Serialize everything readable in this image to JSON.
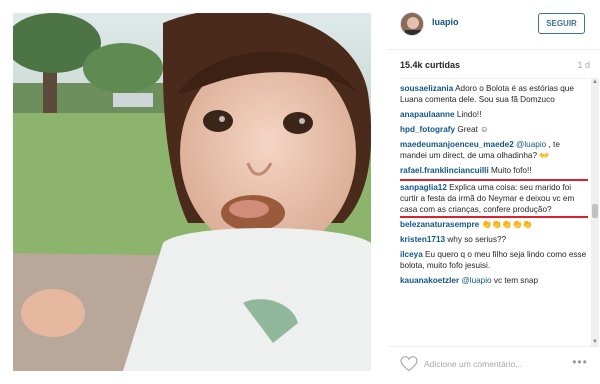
{
  "post": {
    "username": "luapio",
    "follow_label": "SEGUIR",
    "likes": "15.4k curtidas",
    "age": "1 d"
  },
  "comments": [
    {
      "user": "sousaelizania",
      "text": " Adoro o Bolota é as estórias que Luana comenta dele. Sou sua fã Domzuco"
    },
    {
      "user": "anapaulaanne",
      "text": " Lindo!!"
    },
    {
      "user": "hpd_fotografy",
      "text": " Great ☺"
    },
    {
      "user": "maedeumanjoenceu_maede2",
      "mention": " @luapio",
      "text": " , te mandei um direct, de uma olhadinha? 👐"
    },
    {
      "user": "rafael.franklinciancuilli",
      "text": " Muito fofo!!"
    },
    {
      "user": "sanpaglia12",
      "text": " Explica uma coisa: seu marido foi curtir a festa da irmã do Neymar e deixou vc em casa com as crianças, confere produção?"
    },
    {
      "user": "belezanaturasempre",
      "text": " 👏👏👏👏👏"
    },
    {
      "user": "kristen1713",
      "text": " why so serius??"
    },
    {
      "user": "ilceya",
      "text": " Eu quero q o meu filho seja lindo como esse bolota, muito fofo jesuisi."
    },
    {
      "user": "kauanakoetzler",
      "mention": " @luapio",
      "text": " vc tem snap"
    }
  ],
  "footer": {
    "placeholder": "Adicione um comentário..."
  },
  "icons": {
    "like": "heart-icon",
    "more": "more-options-icon"
  },
  "colors": {
    "link": "#125688",
    "follow": "#3f729b",
    "highlight": "#d6232e"
  }
}
